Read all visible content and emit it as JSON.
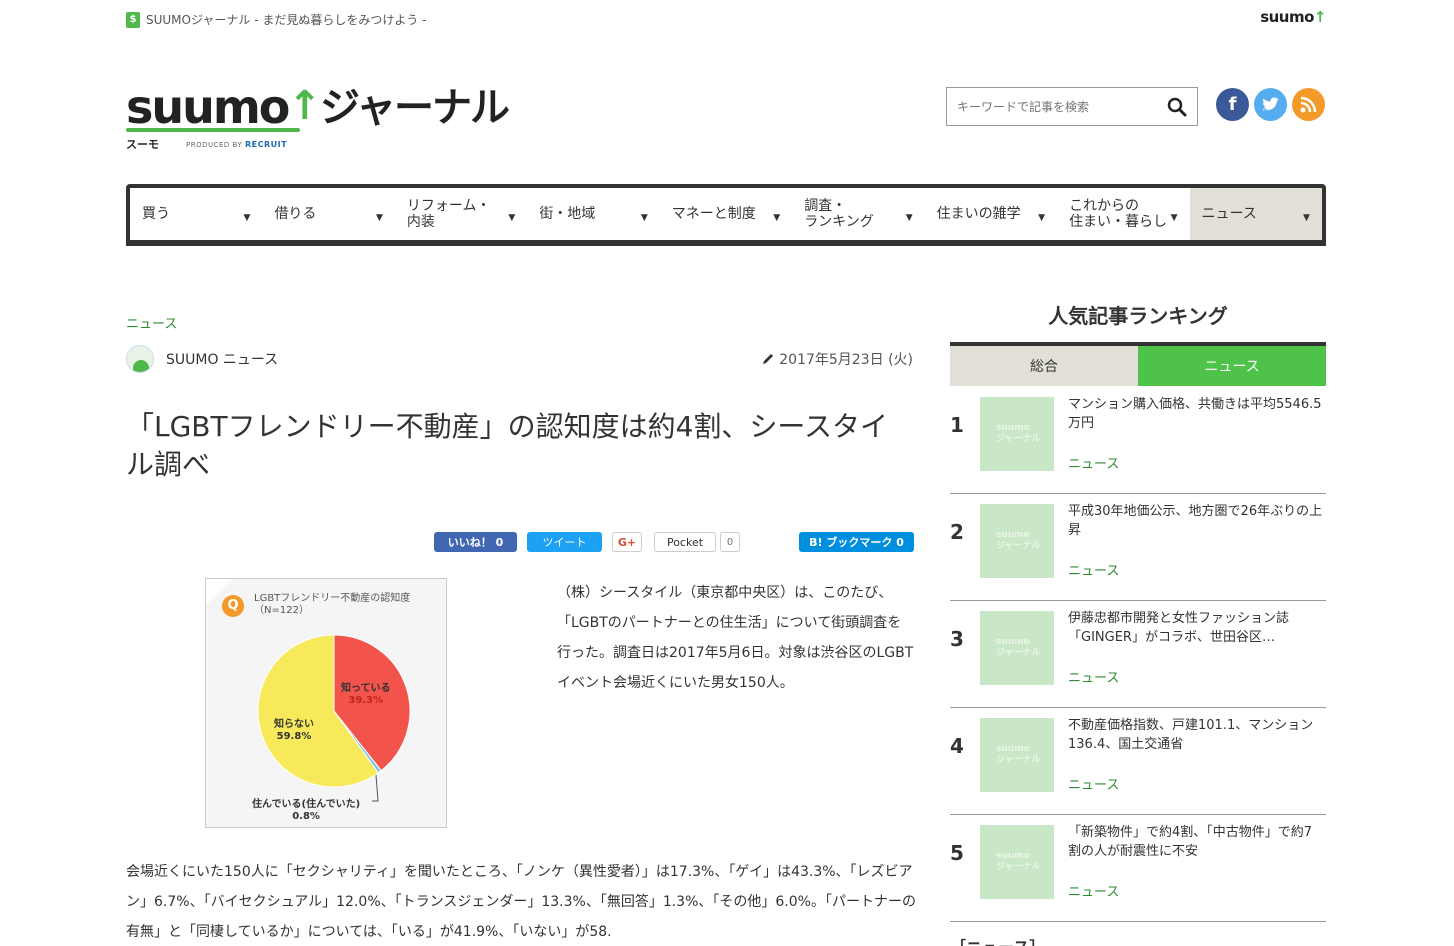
{
  "topbar": {
    "tagline": "SUUMOジャーナル - まだ見ぬ暮らしをみつけよう -",
    "brand": "suumo",
    "tag_icon": "$"
  },
  "logo": {
    "suumo": "suumo",
    "journal": "ジャーナル",
    "kana": "スーモ",
    "produced": "PRODUCED BY",
    "recruit": "RECRUIT"
  },
  "search": {
    "placeholder": "キーワードで記事を検索"
  },
  "social": {
    "facebook": "f",
    "twitter": "t",
    "rss": "r"
  },
  "nav": {
    "items": [
      {
        "label": "買う"
      },
      {
        "label": "借りる"
      },
      {
        "label": "リフォーム・\n内装"
      },
      {
        "label": "街・地域"
      },
      {
        "label": "マネーと制度"
      },
      {
        "label": "調査・\nランキング"
      },
      {
        "label": "住まいの雑学"
      },
      {
        "label": "これからの\n住まい・暮らし"
      },
      {
        "label": "ニュース"
      }
    ],
    "caret": "▼"
  },
  "article": {
    "category": "ニュース",
    "author": "SUUMO ニュース",
    "date": "2017年5月23日 (火)",
    "title": "「LGBTフレンドリー不動産」の認知度は約4割、シースタイル調べ",
    "paragraph1": "（株）シースタイル（東京都中央区）は、このたび、「LGBTのパートナーとの住生活」について街頭調査を行った。調査日は2017年5月6日。対象は渋谷区のLGBTイベント会場近くにいた男女150人。",
    "paragraph2": "会場近くにいた150人に「セクシャリティ」を聞いたところ、「ノンケ（異性愛者）」は17.3%、「ゲイ」は43.3%、「レズビアン」6.7%、「バイセクシュアル」12.0%、「トランスジェンダー」13.3%、「無回答」1.3%、「その他」6.0%。「パートナーの有無」と「同棲しているか」については、「いる」が41.9%、「いない」が58."
  },
  "share": {
    "facebook": "いいね！ 0",
    "twitter": "ツイート",
    "gplus": "G+",
    "pocket": "Pocket",
    "pocket_count": "0",
    "hatena": "B! ブックマーク  0"
  },
  "figure": {
    "q": "Q",
    "title_line1": "LGBTフレンドリー不動産の認知度",
    "title_line2": "（N=122）",
    "slices": [
      {
        "label": "知っている",
        "value_text": "39.3%",
        "value": 39.3,
        "color": "#f2534a"
      },
      {
        "label": "住んでいる(住んでいた)",
        "value_text": "0.8%",
        "value": 0.8,
        "color": "#7fc9e0"
      },
      {
        "label": "知らない",
        "value_text": "59.8%",
        "value": 59.8,
        "color": "#f7e95a"
      }
    ]
  },
  "ranking": {
    "title": "人気記事ランキング",
    "tabs": [
      "総合",
      "ニュース"
    ],
    "thumb_text": "suumo\nジャーナル",
    "items": [
      {
        "rank": "1",
        "text": "マンション購入価格、共働きは平均5546.5万円",
        "category": "ニュース"
      },
      {
        "rank": "2",
        "text": "平成30年地価公示、地方圏で26年ぶりの上昇",
        "category": "ニュース"
      },
      {
        "rank": "3",
        "text": "伊藤忠都市開発と女性ファッション誌「GINGER」がコラボ、世田谷区…",
        "category": "ニュース"
      },
      {
        "rank": "4",
        "text": "不動産価格指数、戸建101.1、マンション136.4、国土交通省",
        "category": "ニュース"
      },
      {
        "rank": "5",
        "text": "「新築物件」で約4割、「中古物件」で約7割の人が耐震性に不安",
        "category": "ニュース"
      }
    ]
  },
  "more": {
    "heading": "［ニュース］"
  },
  "colors": {
    "accent": "#4fb84a",
    "link_green": "#2f8a33",
    "nav_active": "#e2e0d6"
  }
}
